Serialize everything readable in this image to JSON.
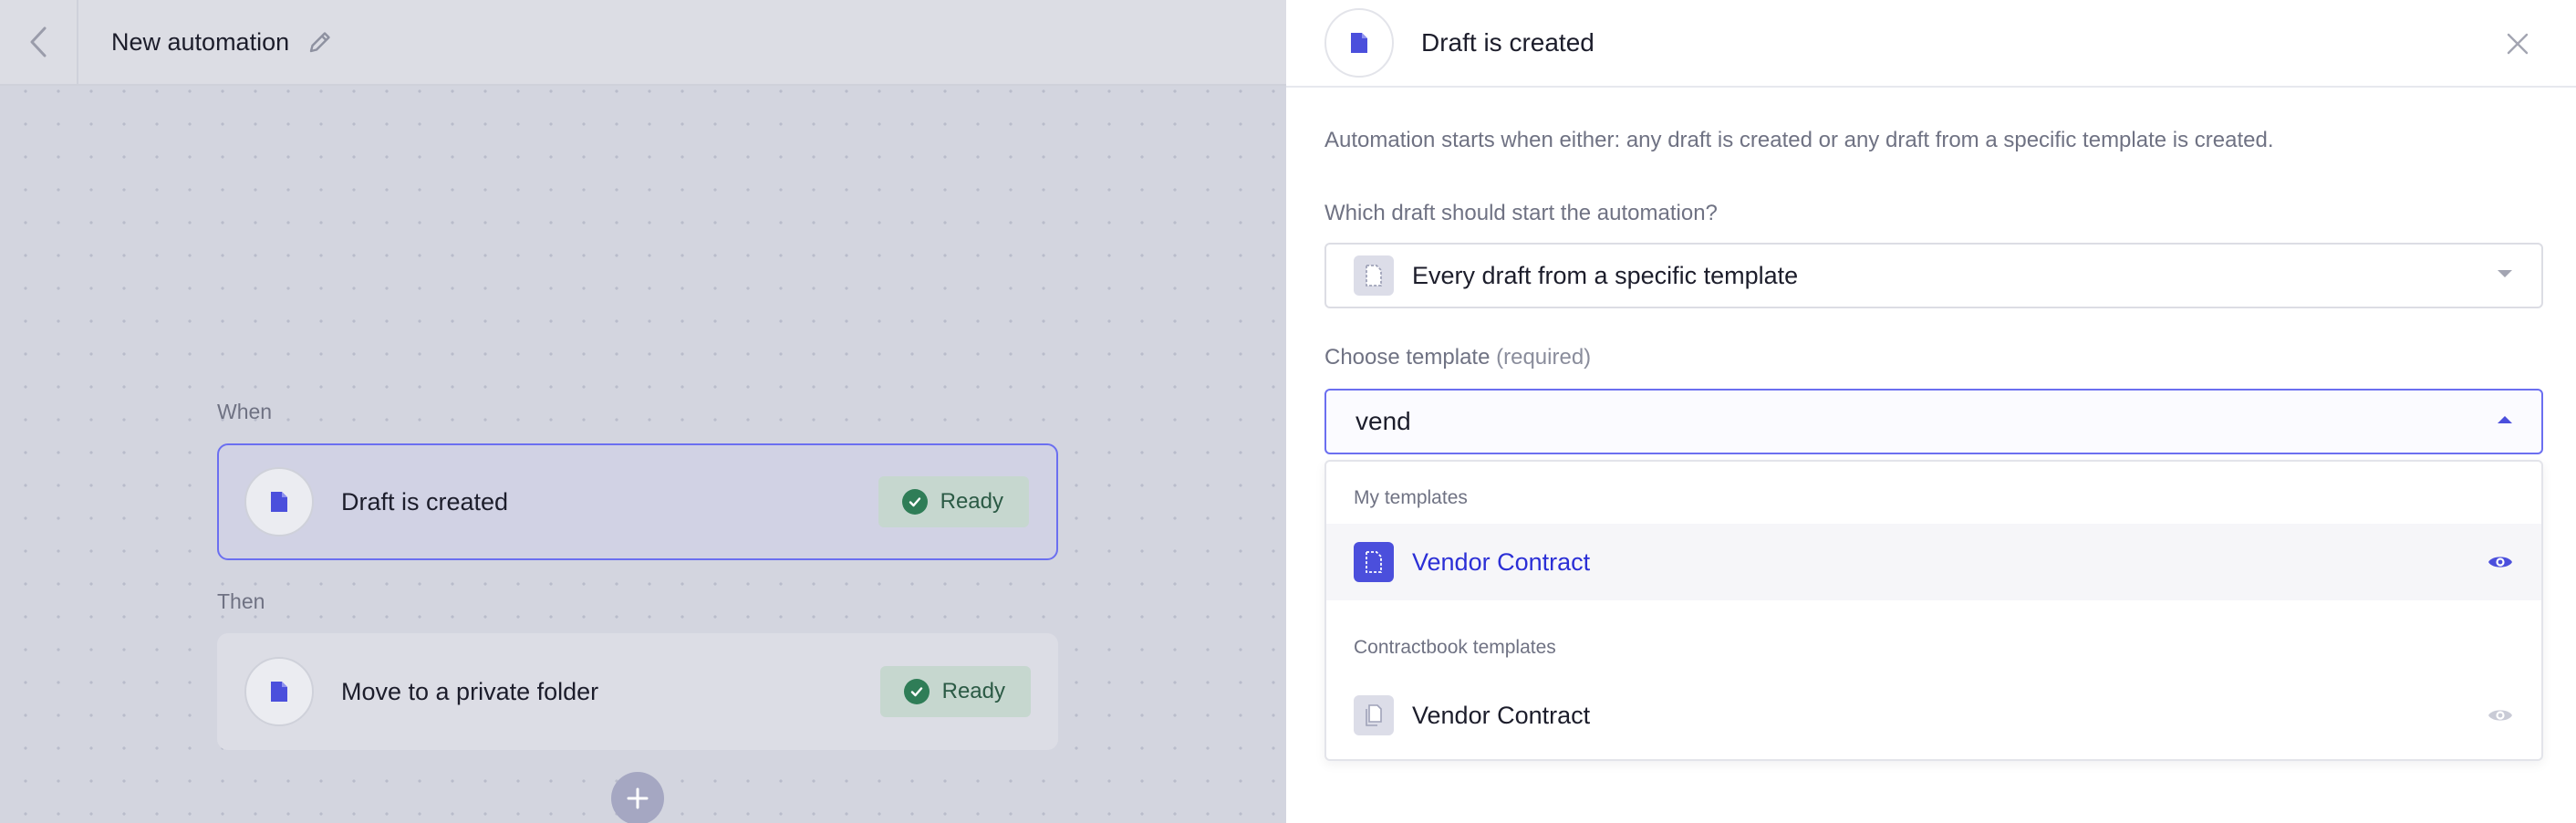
{
  "canvas": {
    "header": {
      "title": "New automation"
    },
    "when_label": "When",
    "then_label": "Then",
    "steps": [
      {
        "title": "Draft is created",
        "status": "Ready",
        "icon": "document-icon",
        "active": true
      },
      {
        "title": "Move to a private folder",
        "status": "Ready",
        "icon": "document-icon",
        "active": false
      }
    ],
    "add_step_icon": "plus-icon"
  },
  "panel": {
    "title": "Draft is created",
    "description": "Automation starts when either: any draft is created or any draft from a specific template is created.",
    "trigger_field": {
      "label": "Which draft should start the automation?",
      "value": "Every draft from a specific template"
    },
    "template_field": {
      "label": "Choose template",
      "required_note": "(required)",
      "value": "vend",
      "placeholder": ""
    },
    "dropdown": {
      "groups": [
        {
          "label": "My templates",
          "options": [
            {
              "label": "Vendor Contract",
              "highlighted": true
            }
          ]
        },
        {
          "label": "Contractbook templates",
          "options": [
            {
              "label": "Vendor Contract",
              "highlighted": false
            }
          ]
        }
      ]
    }
  },
  "colors": {
    "accent": "#4b4fdc",
    "ready_bg": "#c6d7cf",
    "ready_check": "#2f7d57",
    "canvas_bg": "#d3d5df"
  }
}
